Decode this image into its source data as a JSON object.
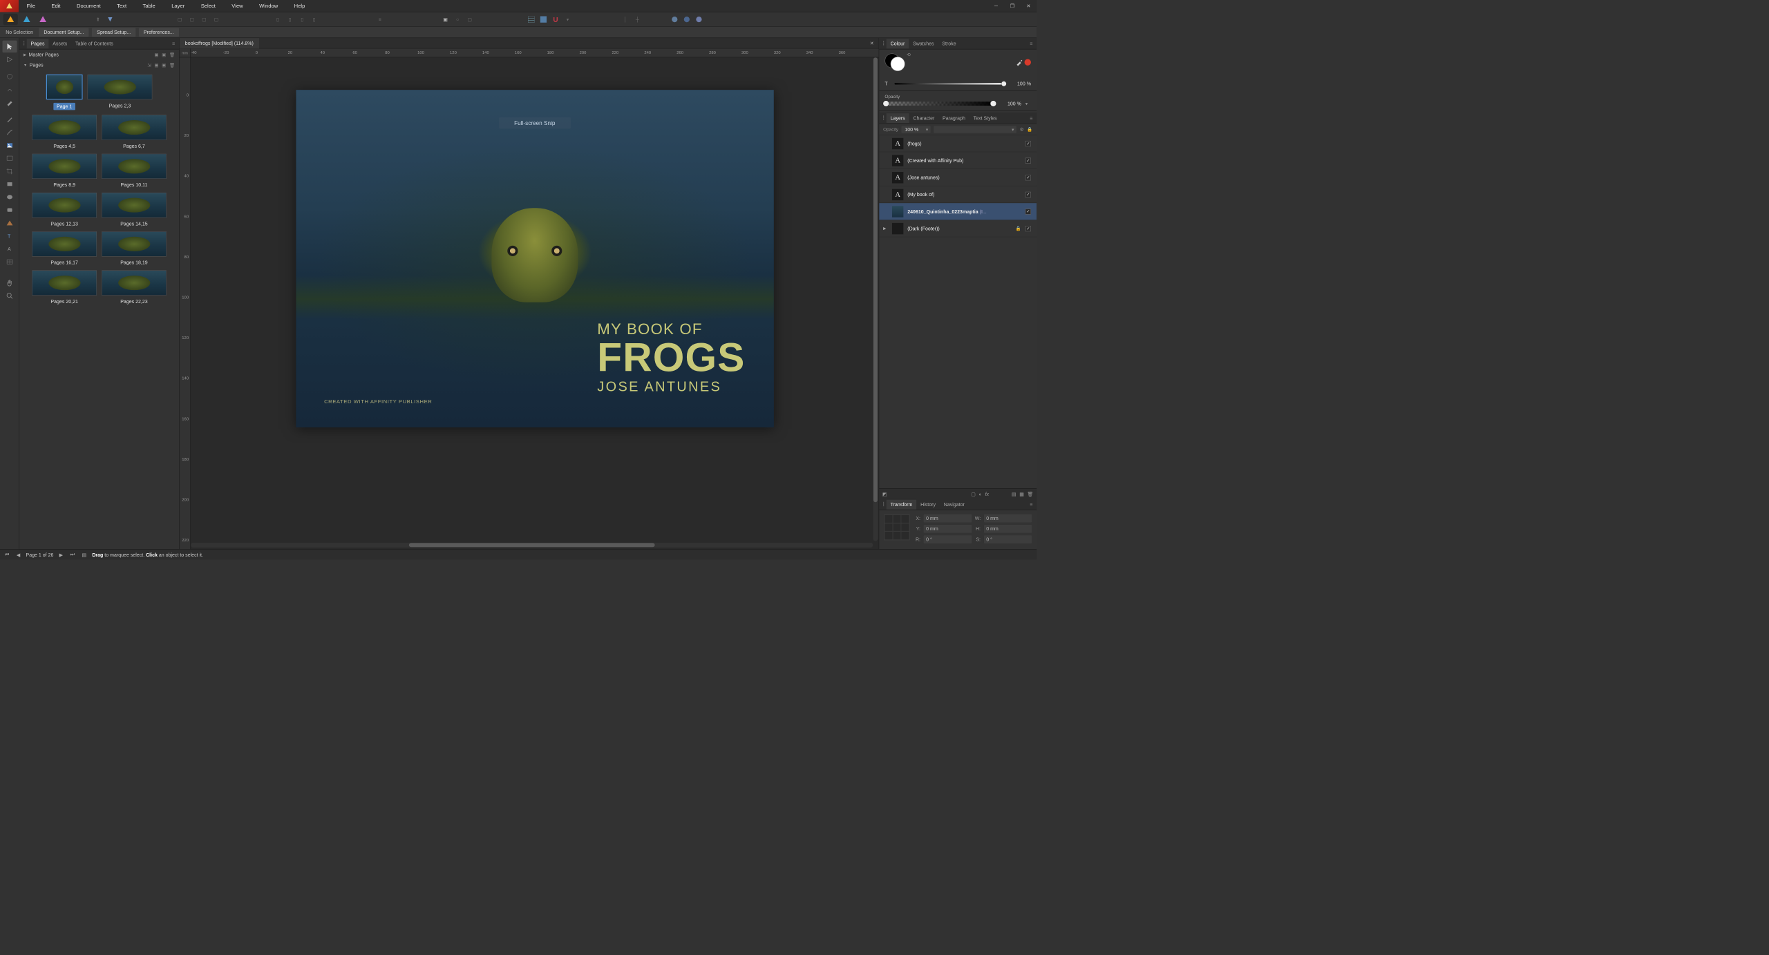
{
  "menu": {
    "file": "File",
    "edit": "Edit",
    "document": "Document",
    "text": "Text",
    "table": "Table",
    "layer": "Layer",
    "select": "Select",
    "view": "View",
    "window": "Window",
    "help": "Help"
  },
  "context": {
    "selection": "No Selection",
    "doc_setup": "Document Setup...",
    "spread_setup": "Spread Setup...",
    "preferences": "Preferences..."
  },
  "left": {
    "tabs": {
      "pages": "Pages",
      "assets": "Assets",
      "toc": "Table of Contents"
    },
    "master": "Master Pages",
    "pages_label": "Pages",
    "items": [
      {
        "l": "Page 1",
        "sel": true,
        "single": true
      },
      {
        "l": "Pages 2,3"
      },
      {
        "l": "Pages 4,5"
      },
      {
        "l": "Pages 6,7"
      },
      {
        "l": "Pages 8,9"
      },
      {
        "l": "Pages 10,11"
      },
      {
        "l": "Pages 12,13"
      },
      {
        "l": "Pages 14,15"
      },
      {
        "l": "Pages 16,17"
      },
      {
        "l": "Pages 18,19"
      },
      {
        "l": "Pages 20,21"
      },
      {
        "l": "Pages 22,23"
      }
    ]
  },
  "doc": {
    "tab": "bookoffrogs [Modified] (114.8%)",
    "ruler_units": "mm",
    "ruler_h": [
      "-40",
      "-20",
      "0",
      "20",
      "40",
      "60",
      "80",
      "100",
      "120",
      "140",
      "160",
      "180",
      "200",
      "220",
      "240",
      "260",
      "280",
      "300",
      "320",
      "340",
      "360"
    ],
    "ruler_v": [
      "0",
      "20",
      "40",
      "60",
      "80",
      "100",
      "120",
      "140",
      "160",
      "180",
      "200",
      "220"
    ],
    "snip": "Full-screen Snip",
    "title_line1": "MY BOOK OF",
    "title_line2": "FROGS",
    "title_line3": "JOSE ANTUNES",
    "credit": "CREATED WITH AFFINITY PUBLISHER"
  },
  "right": {
    "tabs": {
      "colour": "Colour",
      "swatches": "Swatches",
      "stroke": "Stroke"
    },
    "tint_label": "T",
    "tint_value": "100 %",
    "opacity_label": "Opacity",
    "opacity_value": "100 %",
    "layers_tabs": {
      "layers": "Layers",
      "character": "Character",
      "paragraph": "Paragraph",
      "text_styles": "Text Styles"
    },
    "layer_opacity_label": "Opacity",
    "layer_opacity_value": "100 %",
    "layers": [
      {
        "name": "(frogs)",
        "type": "A"
      },
      {
        "name": "(Created with Affinity Pub)",
        "type": "A"
      },
      {
        "name": "(Jose antunes)",
        "type": "A"
      },
      {
        "name": "(My book of)",
        "type": "A"
      },
      {
        "name": "240610_Quintinha_0223maptia",
        "suffix": "(I...",
        "type": "img",
        "sel": true
      },
      {
        "name": "(Dark (Footer))",
        "type": "box",
        "expand": true,
        "lock": true
      }
    ],
    "transform_tabs": {
      "transform": "Transform",
      "history": "History",
      "navigator": "Navigator"
    },
    "xf": {
      "X": "0 mm",
      "Y": "0 mm",
      "W": "0 mm",
      "H": "0 mm",
      "R": "0 °",
      "S": "0 °"
    }
  },
  "status": {
    "page": "Page 1 of 26",
    "hint_drag": "Drag",
    "hint_drag_rest": " to marquee select. ",
    "hint_click": "Click",
    "hint_click_rest": " an object to select it."
  }
}
